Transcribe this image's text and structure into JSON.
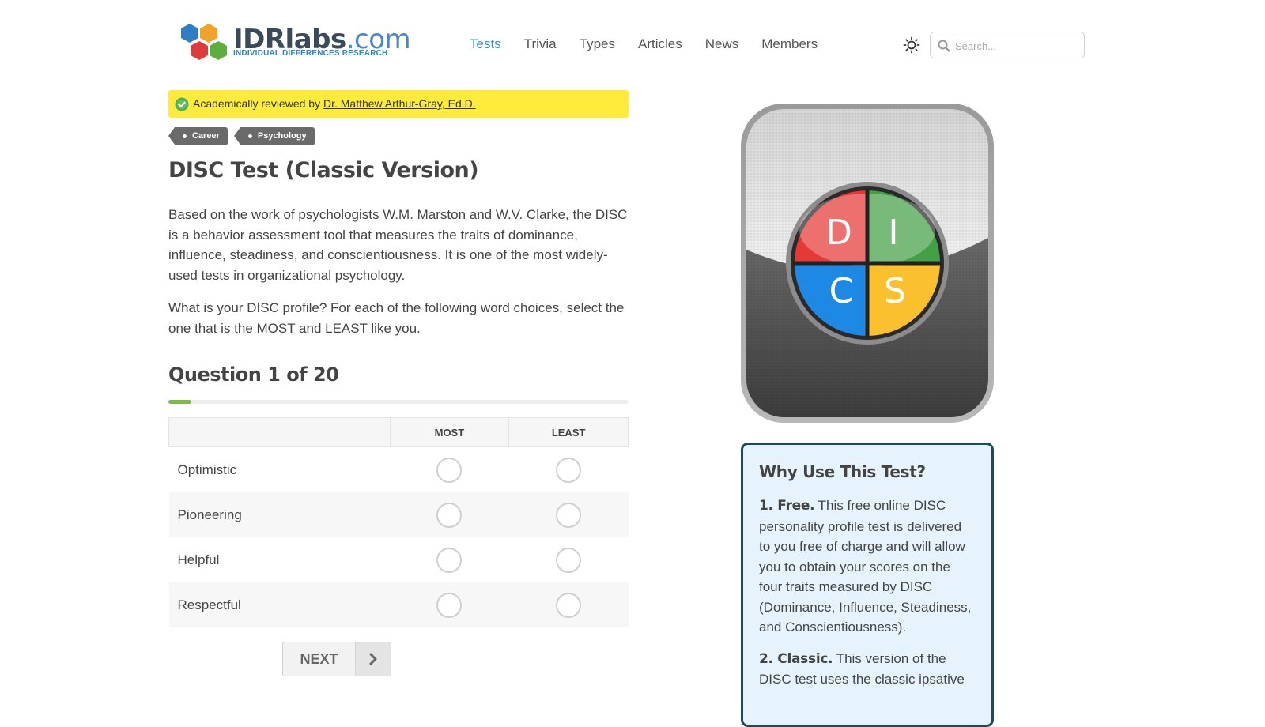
{
  "header": {
    "logo": {
      "word_bold": "IDRlabs",
      "word_dot": ".com",
      "tagline": "INDIVIDUAL DIFFERENCES RESEARCH",
      "hex_colors": [
        "#2e7dc6",
        "#f0a32a",
        "#e03b3b",
        "#5cae3d"
      ]
    },
    "nav": [
      {
        "label": "Tests",
        "active": true
      },
      {
        "label": "Trivia"
      },
      {
        "label": "Types"
      },
      {
        "label": "Articles"
      },
      {
        "label": "News"
      },
      {
        "label": "Members"
      }
    ],
    "theme_toggle_icon": "sun-icon",
    "search": {
      "placeholder": "Search...",
      "icon": "search-icon"
    }
  },
  "review_banner": {
    "prefix": "Academically reviewed by ",
    "reviewer": "Dr. Matthew Arthur-Gray, Ed.D.",
    "icon": "verified-check-icon",
    "bg_color": "#ffeb3b"
  },
  "tags": [
    "Career",
    "Psychology"
  ],
  "page": {
    "title": "DISC Test (Classic Version)",
    "intro": "Based on the work of psychologists W.M. Marston and W.V. Clarke, the DISC is a behavior assessment tool that measures the traits of dominance, influence, steadiness, and conscientiousness. It is one of the most widely-used tests in organizational psychology.",
    "instructions": "What is your DISC profile? For each of the following word choices, select the one that is the MOST and LEAST like you."
  },
  "question": {
    "heading": "Question 1 of 20",
    "progress_fraction": 0.05,
    "columns": {
      "most": "MOST",
      "least": "LEAST"
    },
    "options": [
      "Optimistic",
      "Pioneering",
      "Helpful",
      "Respectful"
    ],
    "next_label": "NEXT"
  },
  "app_icon": {
    "letters": [
      "D",
      "I",
      "C",
      "S"
    ],
    "colors": {
      "D": "#e53935",
      "I": "#43a047",
      "C": "#1e88e5",
      "S": "#fbc02d"
    }
  },
  "why_box": {
    "title": "Why Use This Test?",
    "items": [
      {
        "lead": "1. Free.",
        "text": " This free online DISC personality profile test is delivered to you free of charge and will allow you to obtain your scores on the four traits measured by DISC (Dominance, Influence, Steadiness, and Conscientiousness)."
      },
      {
        "lead": "2. Classic.",
        "text": " This version of the DISC test uses the classic ipsative"
      }
    ]
  },
  "colors": {
    "accent_link": "#3a94c8",
    "progress": "#7cbd4a",
    "why_border": "#1f4a5c",
    "why_bg": "#e7f3fc"
  }
}
